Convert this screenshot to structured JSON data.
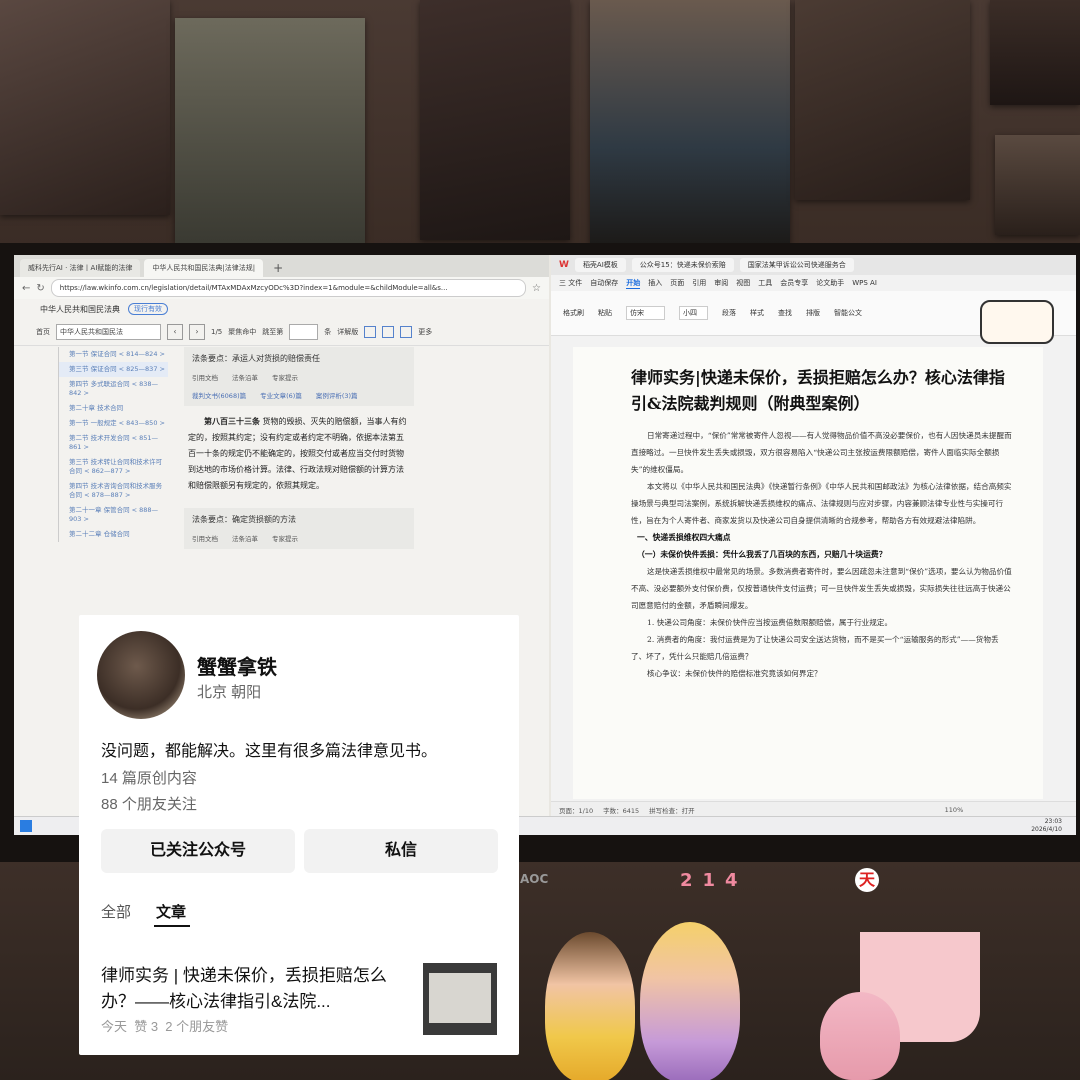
{
  "browser": {
    "tabs": [
      "威科先行AI · 法律丨AI赋能的法律",
      "中华人民共和国民法典|法律法规|"
    ],
    "new_tab": "+",
    "url": "https://law.wkinfo.com.cn/legislation/detail/MTAxMDAxMzcyODc%3D?index=1&module=&childModule=all&s...",
    "site_title": "中华人民共和国民法典",
    "status_pill": "现行有效",
    "toolbar": {
      "home": "首页",
      "search_value": "中华人民共和国民法",
      "page_indicator": "1/5",
      "checkbox_label": "聚焦命中",
      "jump_label": "跳至第",
      "jump_unit": "条",
      "detail_label": "详解版",
      "more": "更多"
    },
    "toc": [
      "第一节 保证合同 < 814—824 >",
      "第三节 保证合同 < 825—837 >",
      "第四节 多式联运合同 < 838—842 >",
      "第二十章 技术合同",
      "第一节 一般规定 < 843—850 >",
      "第二节 技术开发合同 < 851—861 >",
      "第三节 技术转让合同和技术许可合同 < 862—877 >",
      "第四节 技术咨询合同和技术服务合同 < 878—887 >",
      "第二十一章 保管合同 < 888—903 >",
      "第二十二章 仓储合同"
    ],
    "box1_title": "法条要点：承运人对货损的赔偿责任",
    "box_tabs": [
      "引用文档",
      "法条沿革",
      "专家提示"
    ],
    "box1_links": [
      "裁判文书(6068)篇",
      "专业文章(6)篇",
      "案例评析(3)篇"
    ],
    "article_heading": "第八百三十三条",
    "article_text": "货物的毁损、灭失的赔偿额，当事人有约定的，按照其约定；没有约定或者约定不明确，依据本法第五百一十条的规定仍不能确定的，按照交付或者应当交付时货物到达地的市场价格计算。法律、行政法规对赔偿额的计算方法和赔偿限额另有规定的，依照其规定。",
    "box2_title": "法条要点：确定货损额的方法"
  },
  "wps": {
    "tabs": [
      "稻壳AI模板",
      "公众号15：快递未保价索赔",
      "国家法某甲诉讼公司快递服务合"
    ],
    "menu": [
      "三 文件",
      "自动保存",
      "开始",
      "插入",
      "页面",
      "引用",
      "审阅",
      "视图",
      "工具",
      "会员专享",
      "论文助手",
      "WPS AI"
    ],
    "menu_active": "开始",
    "ribbon": [
      "格式刷",
      "粘贴",
      "仿宋",
      "小四",
      "段落",
      "样式",
      "查找",
      "排版",
      "智能公文"
    ],
    "doc_title": "律师实务|快递未保价，丢损拒赔怎么办？核心法律指引&法院裁判规则（附典型案例）",
    "paragraphs": [
      "日常寄递过程中，“保价”常常被寄件人忽视——有人觉得物品价值不高没必要保价，也有人因快递员未提醒而直接略过。一旦快件发生丢失或损毁，双方很容易陷入“快递公司主张按运费限额赔偿，寄件人面临实际全额损失”的维权僵局。",
      "本文将以《中华人民共和国民法典》《快递暂行条例》《中华人民共和国邮政法》为核心法律依据，结合高频实操场景与典型司法案例，系统拆解快递丢损维权的痛点、法律规则与应对步骤，内容兼顾法律专业性与实操可行性，旨在为个人寄件者、商家发货以及快递公司自身提供清晰的合规参考，帮助各方有效规避法律陷阱。"
    ],
    "heading1": "一、快递丢损维权四大痛点",
    "heading2": "（一）未保价快件丢损：凭什么我丢了几百块的东西，只赔几十块运费？",
    "paragraphs2": [
      "这是快递丢损维权中最常见的场景。多数消费者寄件时，要么因疏忽未注意到“保价”选项，要么认为物品价值不高、没必要额外支付保价费，仅按普通快件支付运费；可一旦快件发生丢失或损毁，实际损失往往远高于快递公司愿意赔付的金额，矛盾瞬间爆发。",
      "1. 快递公司角度：未保价快件应当按运费倍数限额赔偿，属于行业规定。",
      "2. 消费者的角度：我付运费是为了让快递公司安全送达货物，而不是买一个“运输服务的形式”——货物丢了、坏了，凭什么只能赔几倍运费？",
      "核心争议：未保价快件的赔偿标准究竟该如何界定？"
    ],
    "status": [
      "页面：1/10",
      "字数：6415",
      "拼写检查：打开",
      "110%"
    ]
  },
  "taskbar": {
    "time": "23:03",
    "date": "2026/4/10"
  },
  "profile": {
    "name": "蟹蟹拿铁",
    "location": "北京 朝阳",
    "bio": "没问题，都能解决。这里有很多篇法律意见书。",
    "original_count": "14 篇原创内容",
    "followers": "88 个朋友关注",
    "followed_button": "已关注公众号",
    "message_button": "私信",
    "tabs": [
      "全部",
      "文章"
    ],
    "active_tab": "文章",
    "article_title": "律师实务 | 快递未保价，丢损拒赔怎么办？——核心法律指引&法院...",
    "article_meta": "今天  赞 3  2 个朋友赞"
  },
  "colors": {
    "accent_blue": "#1a6cde",
    "link_blue": "#4a6fb4",
    "card_bg": "#ffffff"
  },
  "desk": {
    "sticker_text": "214",
    "sticker_char": "天",
    "monitor_brand": "AOC"
  }
}
